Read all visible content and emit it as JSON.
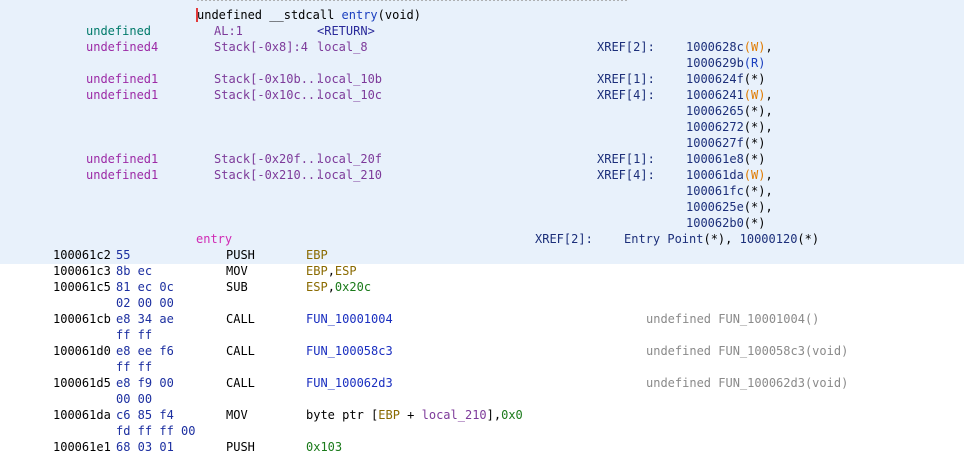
{
  "header": {
    "signature_return": "undefined",
    "signature_convention": "__stdcall",
    "signature_name": "entry",
    "signature_params": "(void)"
  },
  "variables": [
    {
      "type": "undefined",
      "storage": "AL:1",
      "name": "<RETURN>"
    },
    {
      "type": "undefined4",
      "storage": "Stack[-0x8]:4",
      "name": "local_8",
      "xref": "XREF[2]:",
      "refs": [
        {
          "addr": "1000628c",
          "mode": "(W)"
        },
        {
          "addr": "1000629b",
          "mode": "(R)"
        }
      ]
    },
    {
      "type": "undefined1",
      "storage": "Stack[-0x10b...",
      "name": "local_10b",
      "xref": "XREF[1]:",
      "refs": [
        {
          "addr": "1000624f",
          "mode": "(*)"
        }
      ]
    },
    {
      "type": "undefined1",
      "storage": "Stack[-0x10c...",
      "name": "local_10c",
      "xref": "XREF[4]:",
      "refs": [
        {
          "addr": "10006241",
          "mode": "(W)"
        },
        {
          "addr": "10006265",
          "mode": "(*)"
        },
        {
          "addr": "10006272",
          "mode": "(*)"
        },
        {
          "addr": "1000627f",
          "mode": "(*)"
        }
      ]
    },
    {
      "type": "undefined1",
      "storage": "Stack[-0x20f...",
      "name": "local_20f",
      "xref": "XREF[1]:",
      "refs": [
        {
          "addr": "100061e8",
          "mode": "(*)"
        }
      ]
    },
    {
      "type": "undefined1",
      "storage": "Stack[-0x210...",
      "name": "local_210",
      "xref": "XREF[4]:",
      "refs": [
        {
          "addr": "100061da",
          "mode": "(W)"
        },
        {
          "addr": "100061fc",
          "mode": "(*)"
        },
        {
          "addr": "1000625e",
          "mode": "(*)"
        },
        {
          "addr": "100062b0",
          "mode": "(*)"
        }
      ]
    }
  ],
  "label_row": {
    "label": "entry",
    "xref": "XREF[2]:",
    "ref1": "Entry Point",
    "ref1_mode": "(*)",
    "ref2": "10000120",
    "ref2_mode": "(*)"
  },
  "instructions": [
    {
      "addr": "100061c2",
      "bytes": "55",
      "mnemonic": "PUSH",
      "ops": [
        {
          "t": "EBP",
          "k": "reg"
        }
      ]
    },
    {
      "addr": "100061c3",
      "bytes": "8b ec",
      "mnemonic": "MOV",
      "ops": [
        {
          "t": "EBP",
          "k": "reg"
        },
        {
          "t": ",",
          "k": "plain"
        },
        {
          "t": "ESP",
          "k": "reg"
        }
      ]
    },
    {
      "addr": "100061c5",
      "bytes": "81 ec 0c",
      "bytes2": "02 00 00",
      "mnemonic": "SUB",
      "ops": [
        {
          "t": "ESP",
          "k": "reg"
        },
        {
          "t": ",",
          "k": "plain"
        },
        {
          "t": "0x20c",
          "k": "num"
        }
      ]
    },
    {
      "addr": "100061cb",
      "bytes": "e8 34 ae",
      "bytes2": "ff ff",
      "mnemonic": "CALL",
      "ops": [
        {
          "t": "FUN_10001004",
          "k": "lbl"
        }
      ],
      "comment": "undefined FUN_10001004()"
    },
    {
      "addr": "100061d0",
      "bytes": "e8 ee f6",
      "bytes2": "ff ff",
      "mnemonic": "CALL",
      "ops": [
        {
          "t": "FUN_100058c3",
          "k": "lbl"
        }
      ],
      "comment": "undefined FUN_100058c3(void)"
    },
    {
      "addr": "100061d5",
      "bytes": "e8 f9 00",
      "bytes2": "00 00",
      "mnemonic": "CALL",
      "ops": [
        {
          "t": "FUN_100062d3",
          "k": "lbl"
        }
      ],
      "comment": "undefined FUN_100062d3(void)"
    },
    {
      "addr": "100061da",
      "bytes": "c6 85 f4",
      "bytes2": "fd ff ff 00",
      "mnemonic": "MOV",
      "ops": [
        {
          "t": "byte ptr [",
          "k": "plain"
        },
        {
          "t": "EBP",
          "k": "reg"
        },
        {
          "t": " + ",
          "k": "plain"
        },
        {
          "t": "local_210",
          "k": "local"
        },
        {
          "t": "],",
          "k": "plain"
        },
        {
          "t": "0x0",
          "k": "num"
        }
      ]
    },
    {
      "addr": "100061e1",
      "bytes": "68 03 01",
      "mnemonic": "PUSH",
      "ops": [
        {
          "t": "0x103",
          "k": "num"
        }
      ]
    }
  ]
}
